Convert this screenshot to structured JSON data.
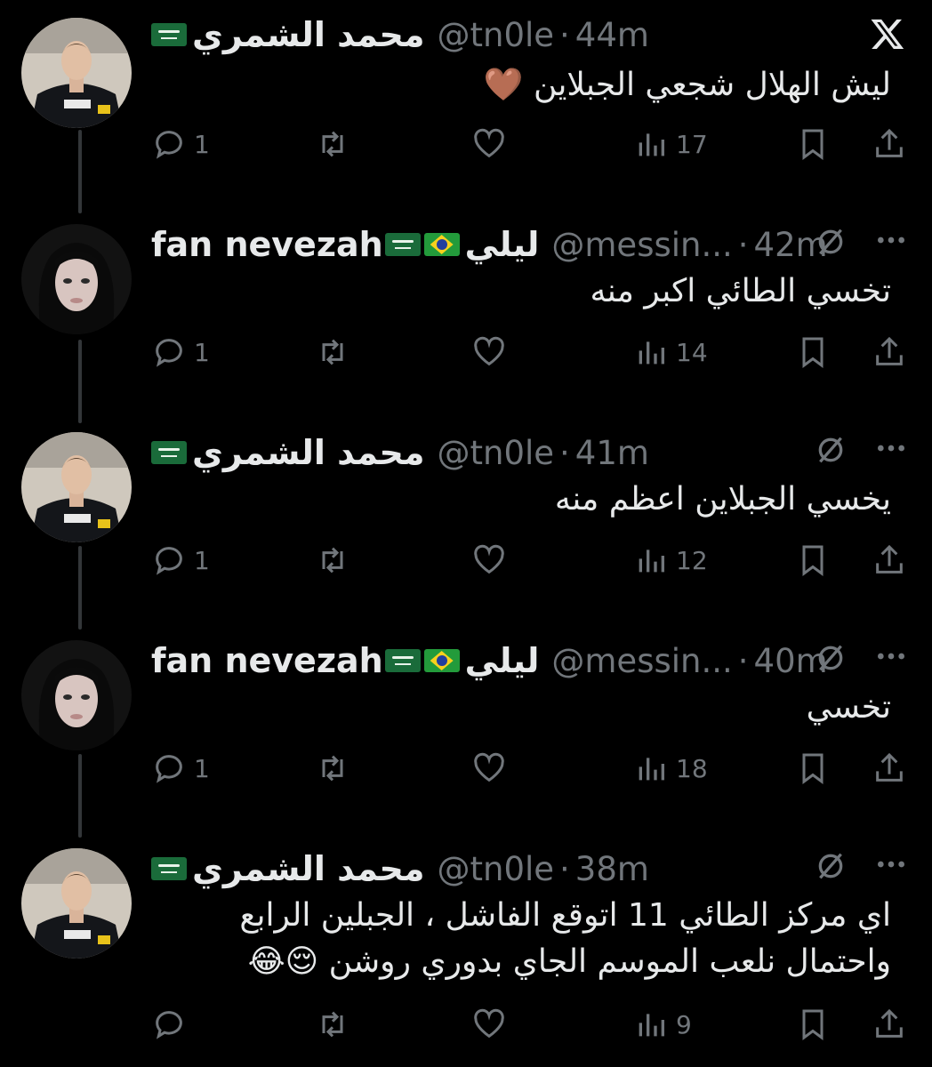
{
  "app": {
    "logo": "x-logo"
  },
  "icons": {
    "reply": "reply-icon",
    "retweet": "retweet-icon",
    "like": "heart-icon",
    "views": "views-icon",
    "bookmark": "bookmark-icon",
    "share": "share-icon",
    "muted": "no-notifications-icon",
    "more": "more-icon"
  },
  "colors": {
    "background": "#000000",
    "text": "#e7e9ea",
    "secondary": "#71767b",
    "thread_line": "#333639"
  },
  "tweets": [
    {
      "name_ar": "محمد الشمري",
      "name_latin": "",
      "flags": [
        "sa"
      ],
      "handle": "@tn0le",
      "time": "44m",
      "text_lines": [
        "ليش الهلال شجعي الجبلاين 🤎"
      ],
      "replies": "1",
      "retweets": "",
      "likes": "",
      "views": "17"
    },
    {
      "name_ar": "ليلي",
      "name_latin": "fan nevezah",
      "flags": [
        "sa",
        "br"
      ],
      "handle": "@messin...",
      "time": "42m",
      "text_lines": [
        "تخسي الطائي اكبر منه"
      ],
      "replies": "1",
      "retweets": "",
      "likes": "",
      "views": "14"
    },
    {
      "name_ar": "محمد الشمري",
      "name_latin": "",
      "flags": [
        "sa"
      ],
      "handle": "@tn0le",
      "time": "41m",
      "text_lines": [
        "يخسي الجبلاين اعظم منه"
      ],
      "replies": "1",
      "retweets": "",
      "likes": "",
      "views": "12"
    },
    {
      "name_ar": "ليلي",
      "name_latin": "fan nevezah",
      "flags": [
        "sa",
        "br"
      ],
      "handle": "@messin...",
      "time": "40m",
      "text_lines": [
        "تخسي"
      ],
      "replies": "1",
      "retweets": "",
      "likes": "",
      "views": "18"
    },
    {
      "name_ar": "محمد الشمري",
      "name_latin": "",
      "flags": [
        "sa"
      ],
      "handle": "@tn0le",
      "time": "38m",
      "text_lines": [
        "اي مركز الطائي 11 اتوقع الفاشل ، الجبلين الرابع",
        "واحتمال نلعب الموسم الجاي بدوري روشن 😌😂"
      ],
      "replies": "",
      "retweets": "",
      "likes": "",
      "views": "9"
    }
  ]
}
